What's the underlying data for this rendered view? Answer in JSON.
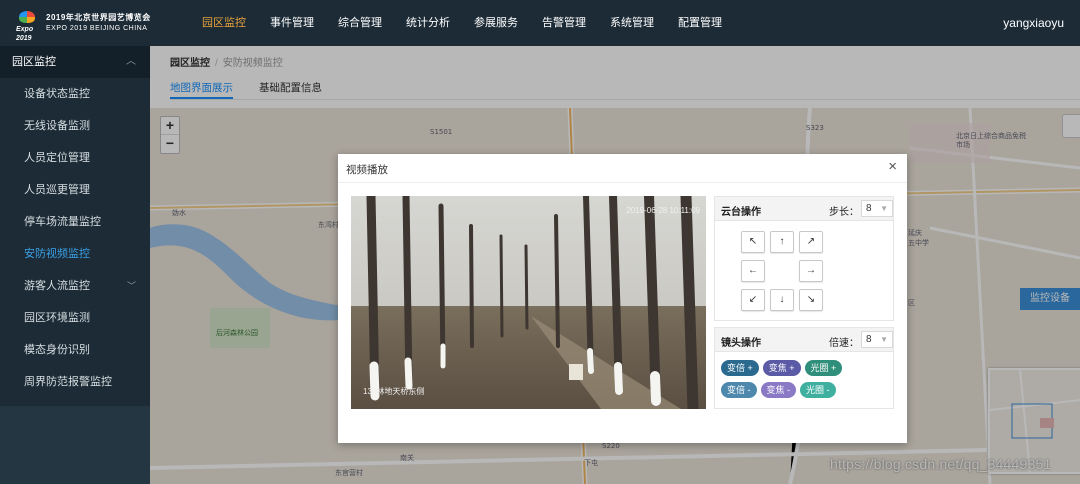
{
  "brand": {
    "title_cn": "2019年北京世界园艺博览会",
    "title_en": "EXPO 2019 BEIJING CHINA",
    "mark": "Expo 2019"
  },
  "nav": [
    "园区监控",
    "事件管理",
    "综合管理",
    "统计分析",
    "参展服务",
    "告警管理",
    "系统管理",
    "配置管理"
  ],
  "user": "yangxiaoyu",
  "sidebar": {
    "header": "园区监控",
    "items": [
      "设备状态监控",
      "无线设备监测",
      "人员定位管理",
      "人员巡更管理",
      "停车场流量监控",
      "安防视频监控",
      "游客人流监控",
      "园区环境监测",
      "模态身份识别",
      "周界防范报警监控"
    ]
  },
  "breadcrumb": {
    "root": "园区监控",
    "sep": "/",
    "current": "安防视频监控"
  },
  "tabs": [
    "地图界面展示",
    "基础配置信息"
  ],
  "map": {
    "zoom_in": "+",
    "zoom_out": "−",
    "monitor_button": "监控设备",
    "labels": [
      "S1501",
      "S323",
      "北京日上综合商品免税市场",
      "S220",
      "东官营村",
      "下屯",
      "后河森林公园",
      "延庆",
      "五中学",
      "区",
      "妫水",
      "东湾村",
      "南关"
    ],
    "watermark": "https://blog.csdn.net/qq_34449351"
  },
  "modal": {
    "title": "视频播放",
    "close": "×",
    "video": {
      "timestamp": "2019-06-28 10:11:09",
      "caption": "137林地天桥东侧"
    },
    "ptz": {
      "title": "云台操作",
      "step_label": "步长：",
      "step_value": "8",
      "arrows": [
        "↖",
        "↑",
        "↗",
        "←",
        "→",
        "↙",
        "↓",
        "↘"
      ]
    },
    "lens": {
      "title": "镜头操作",
      "speed_label": "倍速：",
      "speed_value": "8",
      "buttons_row1": [
        "变倍 +",
        "变焦 +",
        "光圈 +"
      ],
      "buttons_row2": [
        "变倍 -",
        "变焦 -",
        "光圈 -"
      ]
    }
  },
  "colors": {
    "nav_bg": "#1c2b36",
    "nav_active": "#e8a33c",
    "sidebar_active": "#3aa0e6",
    "pill_zoom": "#2a6a8f",
    "pill_focus": "#5a5aa6",
    "pill_iris": "#2f8f7a"
  }
}
